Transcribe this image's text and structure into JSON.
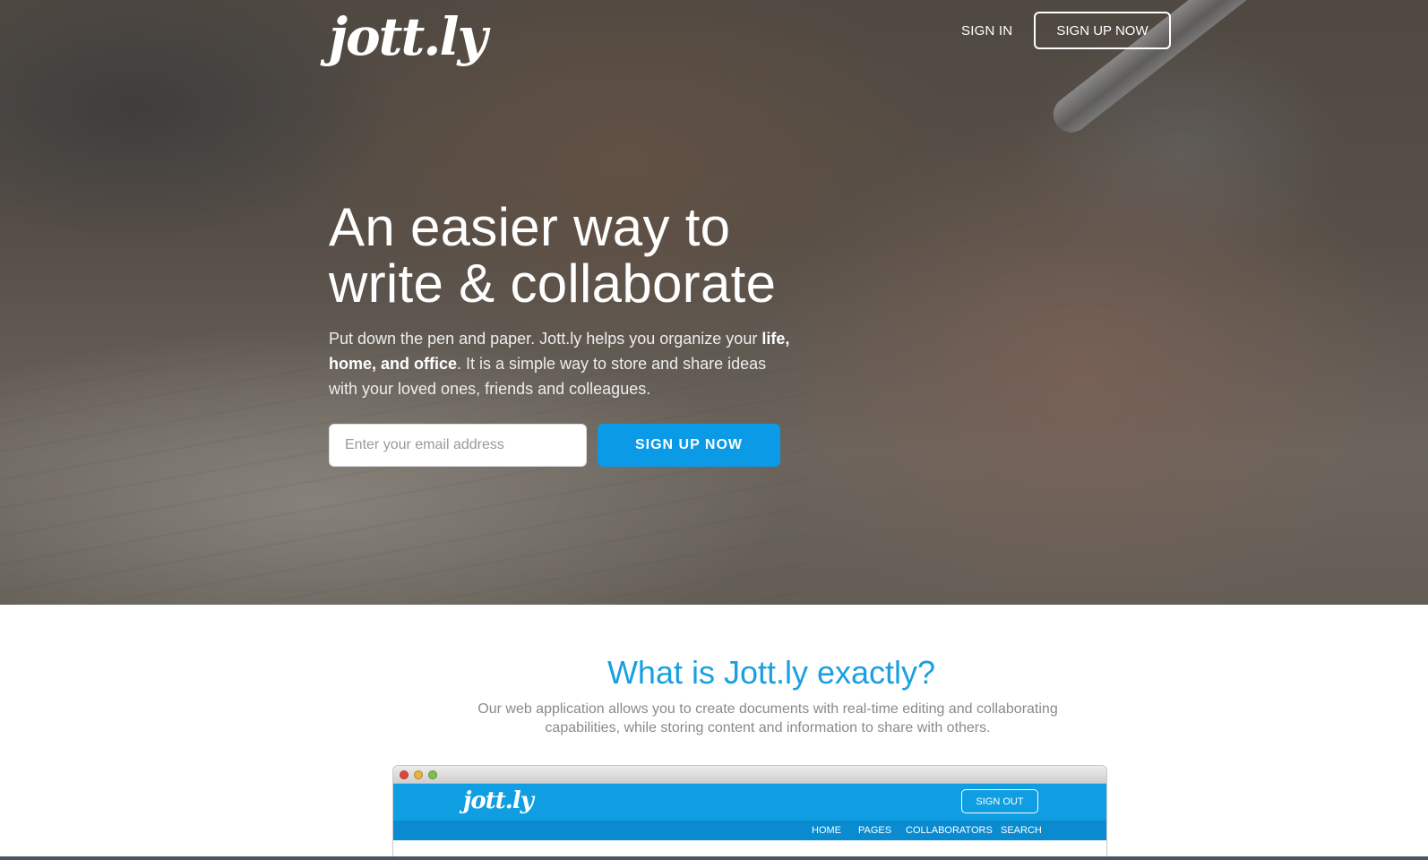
{
  "brand": {
    "logo_text": "jott.ly"
  },
  "nav": {
    "sign_in": "SIGN IN",
    "sign_up": "SIGN UP NOW"
  },
  "hero": {
    "headline_line1": "An easier way to",
    "headline_line2": "write & collaborate",
    "sub_part1": "Put down the pen and paper. Jott.ly helps you organize your ",
    "sub_bold": "life, home, and office",
    "sub_part2": ". It is a simple way to store and share ideas with your loved ones, friends and colleagues.",
    "email_placeholder": "Enter your email address",
    "cta_label": "SIGN UP NOW"
  },
  "intro": {
    "title": "What is Jott.ly exactly?",
    "text": "Our web application allows you to create documents with real-time editing and collaborating capabilities, while storing content and information to share with others."
  },
  "preview": {
    "logo_text": "jott.ly",
    "sign_out": "SIGN OUT",
    "nav": [
      "HOME",
      "PAGES",
      "COLLABORATORS",
      "SEARCH"
    ]
  },
  "colors": {
    "accent": "#0b9be6",
    "title_blue": "#1aa0e0",
    "muted_text": "#8a8a8a"
  }
}
